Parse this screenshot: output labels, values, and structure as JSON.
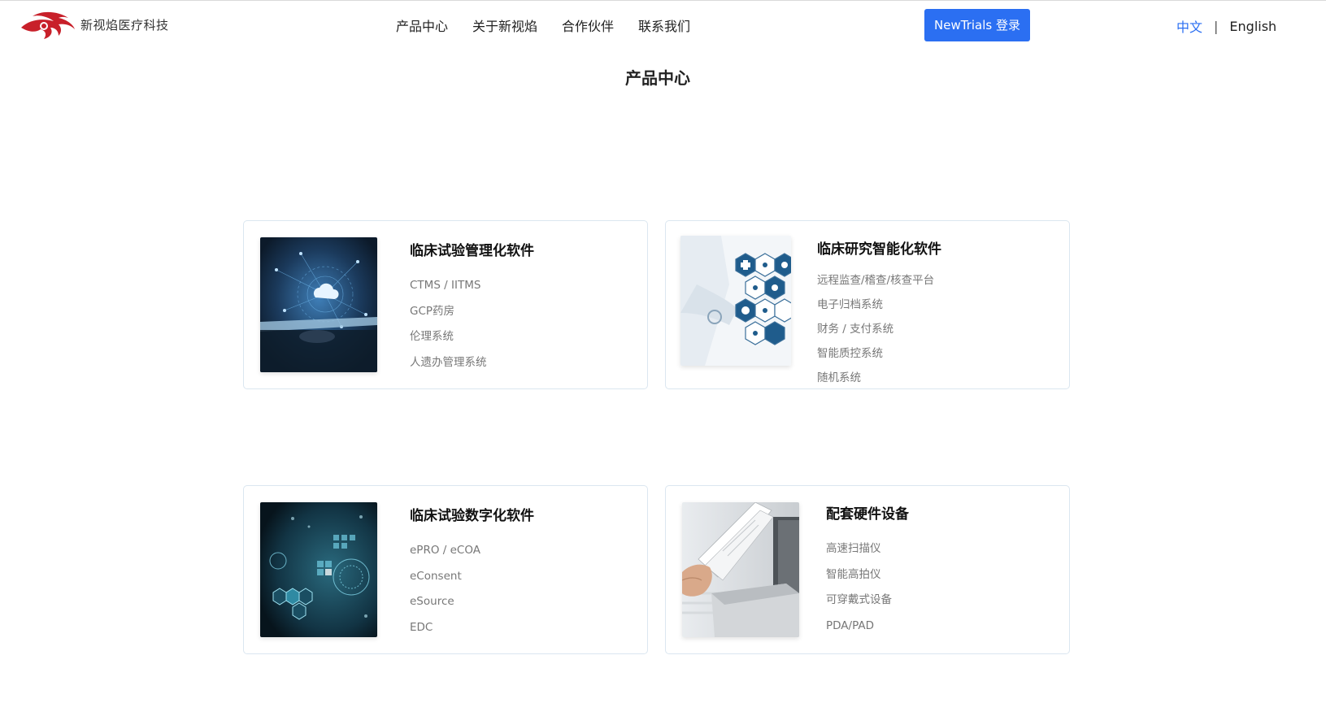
{
  "header": {
    "brand": "新视焰医疗科技",
    "nav": [
      "产品中心",
      "关于新视焰",
      "合作伙伴",
      "联系我们"
    ],
    "login_button": "NewTrials 登录",
    "lang_zh": "中文",
    "lang_separator": "|",
    "lang_en": "English"
  },
  "page_title": "产品中心",
  "cards": [
    {
      "title": "临床试验管理化软件",
      "items": [
        "CTMS / IITMS",
        "GCP药房",
        "伦理系统",
        "人遗办管理系统"
      ]
    },
    {
      "title": "临床研究智能化软件",
      "items": [
        "远程监查/稽查/核查平台",
        "电子归档系统",
        "财务 / 支付系统",
        "智能质控系统",
        "随机系统"
      ]
    },
    {
      "title": "临床试验数字化软件",
      "items": [
        "ePRO / eCOA",
        "eConsent",
        "eSource",
        "EDC"
      ]
    },
    {
      "title": "配套硬件设备",
      "items": [
        "高速扫描仪",
        "智能高拍仪",
        "可穿戴式设备",
        "PDA/PAD"
      ]
    }
  ],
  "colors": {
    "accent": "#2b6ff2",
    "logo_red": "#c8202a",
    "card_border": "#dbe6f0"
  }
}
